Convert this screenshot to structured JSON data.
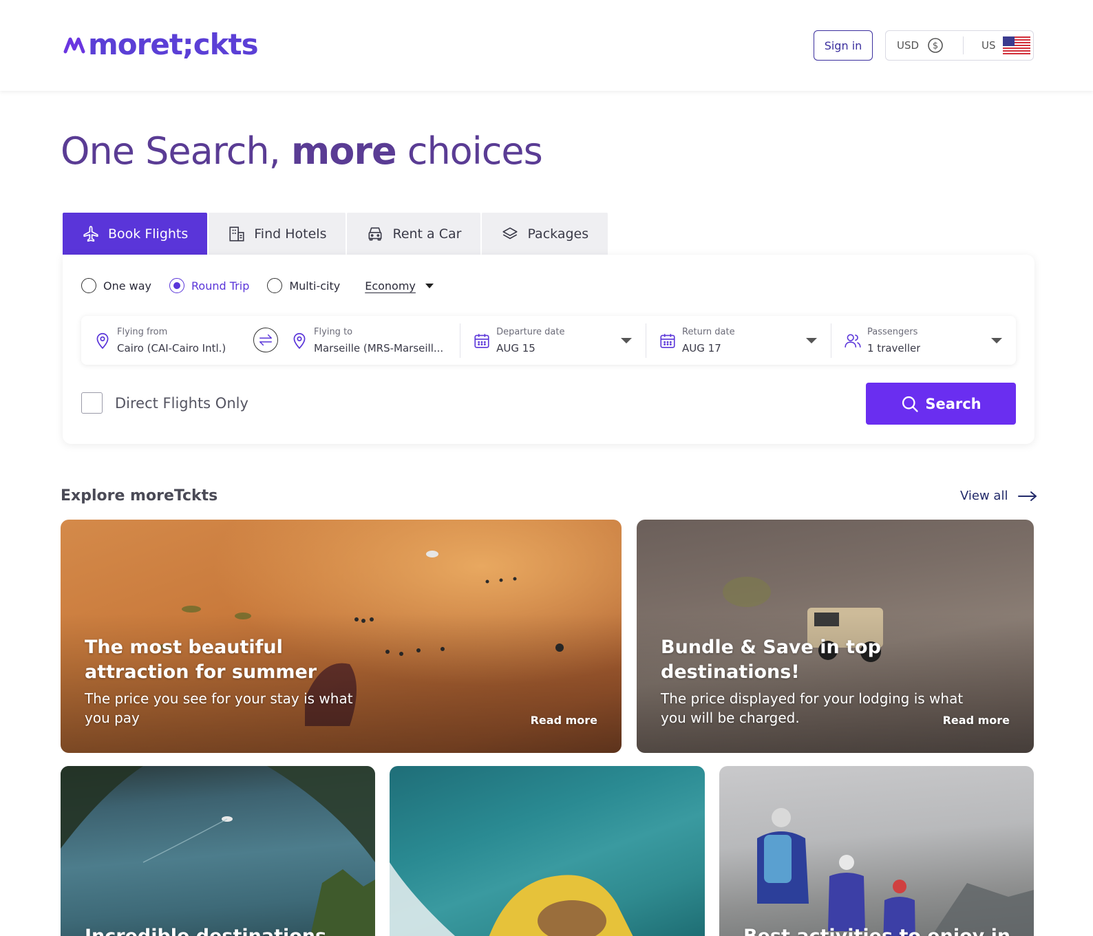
{
  "header": {
    "logo_text": "moret;ckts",
    "sign_in_label": "Sign in",
    "currency": "USD",
    "country": "US"
  },
  "hero": {
    "title_part1": "One Search, ",
    "title_bold": "more",
    "title_part2": " choices"
  },
  "tabs": [
    {
      "label": "Book Flights",
      "icon": "plane-icon",
      "active": true
    },
    {
      "label": "Find Hotels",
      "icon": "hotel-icon",
      "active": false
    },
    {
      "label": "Rent a Car",
      "icon": "car-icon",
      "active": false
    },
    {
      "label": "Packages",
      "icon": "layers-icon",
      "active": false
    }
  ],
  "search": {
    "trip_types": [
      {
        "label": "One way",
        "checked": false
      },
      {
        "label": "Round Trip",
        "checked": true
      },
      {
        "label": "Multi-city",
        "checked": false
      }
    ],
    "cabin_class": "Economy",
    "from_label": "Flying from",
    "from_value": "Cairo (CAI-Cairo Intl.)",
    "to_label": "Flying to",
    "to_value": "Marseille (MRS-Marseill...",
    "departure_label": "Departure date",
    "departure_value": "AUG 15",
    "return_label": "Return date",
    "return_value": "AUG 17",
    "passengers_label": "Passengers",
    "passengers_value": "1 traveller",
    "direct_only_label": "Direct Flights Only",
    "direct_only_checked": false,
    "search_button": "Search"
  },
  "explore": {
    "title": "Explore moreTckts",
    "view_all": "View all",
    "cards": [
      {
        "title_line1": "The most beautiful",
        "title_line2": "attraction for summer",
        "desc_line1": "The price you see for your stay is what",
        "desc_line2": "you pay",
        "read_more": "Read more"
      },
      {
        "title_line1": "Bundle & Save in top",
        "title_line2": "destinations!",
        "desc_line1": "The price displayed for your lodging is what",
        "desc_line2": "you will be charged.",
        "read_more": "Read more"
      },
      {
        "title_line1": "Incredible destinations"
      },
      {
        "title_line1": ""
      },
      {
        "title_line1": "Best activities to enjoy in"
      }
    ]
  },
  "colors": {
    "brand": "#5a35d9",
    "search_button": "#6a2ef0",
    "hero_text": "#5a3c94"
  }
}
